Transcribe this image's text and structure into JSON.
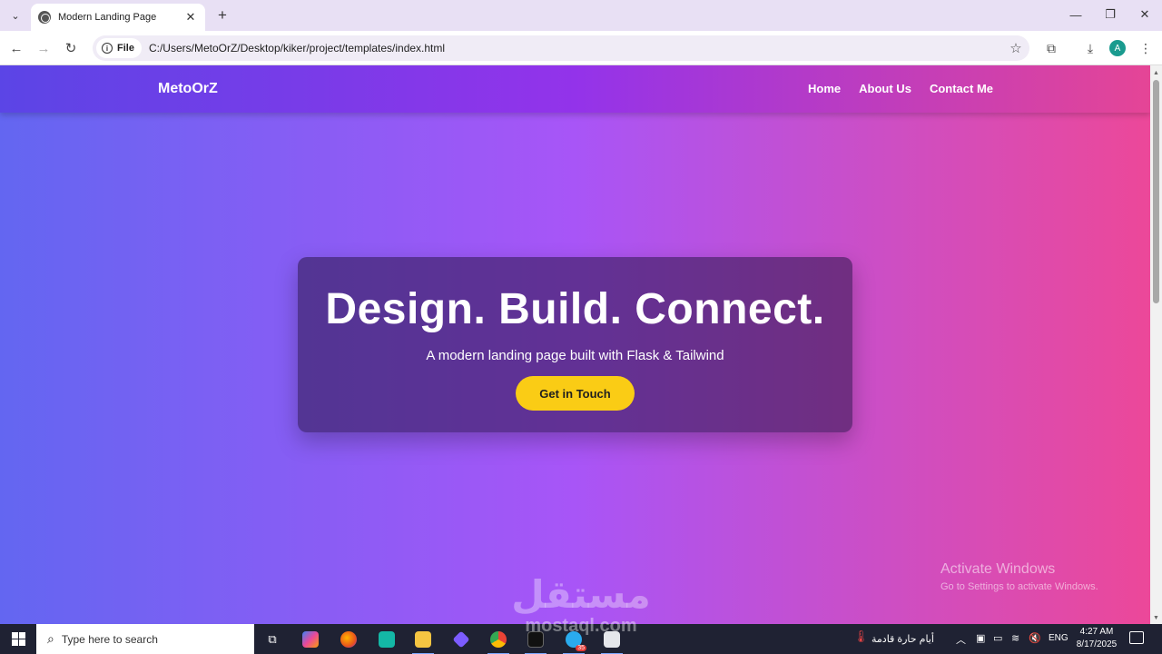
{
  "browser": {
    "tab_title": "Modern Landing Page",
    "tab_close": "✕",
    "new_tab": "+",
    "file_label": "File",
    "url": "C:/Users/MetoOrZ/Desktop/kiker/project/templates/index.html",
    "profile_initial": "A"
  },
  "site": {
    "brand": "MetoOrZ",
    "nav": [
      "Home",
      "About Us",
      "Contact Me"
    ],
    "hero_title": "Design. Build. Connect.",
    "hero_subtitle": "A modern landing page built with Flask & Tailwind",
    "cta_label": "Get in Touch",
    "colors": {
      "gradient_start": "#6366f1",
      "gradient_mid": "#a855f7",
      "gradient_end": "#ec4899",
      "cta": "#facc15"
    }
  },
  "overlay": {
    "activate_title": "Activate Windows",
    "activate_sub": "Go to Settings to activate Windows.",
    "watermark_arabic": "مستقل",
    "watermark_latin": "mostaql.com"
  },
  "taskbar": {
    "search_placeholder": "Type here to search",
    "weather_text": "أيام حارة قادمة",
    "language": "ENG",
    "time": "4:27 AM",
    "date": "8/17/2025",
    "telegram_badge": "35"
  }
}
